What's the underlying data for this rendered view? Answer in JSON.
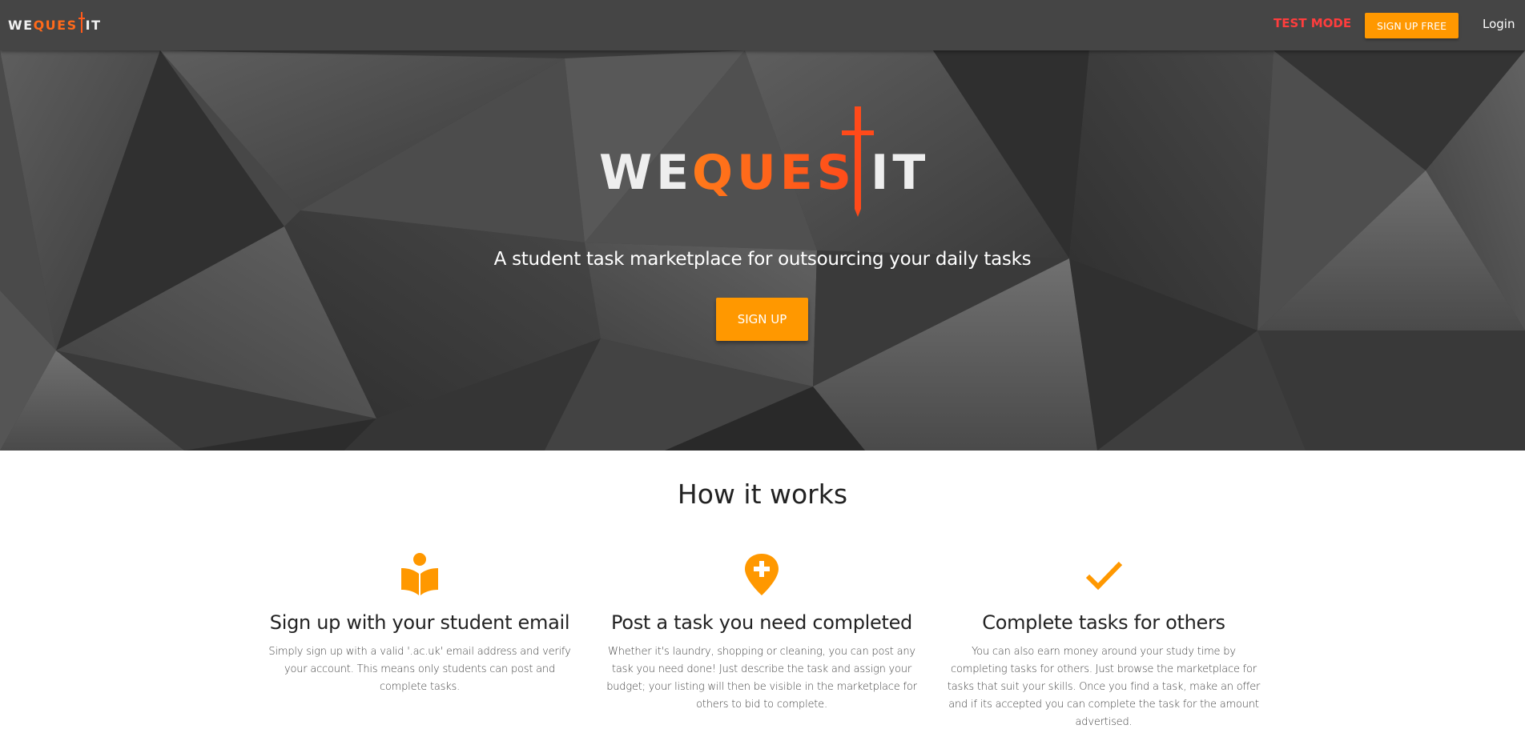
{
  "brand": {
    "logo_parts": [
      "WE",
      "QUES",
      "IT"
    ],
    "accent": "#ff9800",
    "logo_orange": "#ff6a1a"
  },
  "nav": {
    "test_mode": "TEST MODE",
    "signup_label": "SIGN UP FREE",
    "login_label": "Login"
  },
  "hero": {
    "tagline": "A student task marketplace for outsourcing your daily tasks",
    "signup_label": "SIGN UP"
  },
  "how_it_works": {
    "title": "How it works",
    "features": [
      {
        "icon": "book-reader-icon",
        "title": "Sign up with your student email",
        "text": "Simply sign up with a valid '.ac.uk' email address and verify your account. This means only students can post and complete tasks."
      },
      {
        "icon": "map-pin-plus-icon",
        "title": "Post a task you need completed",
        "text": "Whether it's laundry, shopping or cleaning, you can post any task you need done! Just describe the task and assign your budget; your listing will then be visible in the marketplace for others to bid to complete."
      },
      {
        "icon": "checkmark-icon",
        "title": "Complete tasks for others",
        "text": "You can also earn money around your study time by completing tasks for others. Just browse the marketplace for tasks that suit your skills. Once you find a task, make an offer and if its accepted you can complete the task for the amount advertised."
      }
    ]
  }
}
